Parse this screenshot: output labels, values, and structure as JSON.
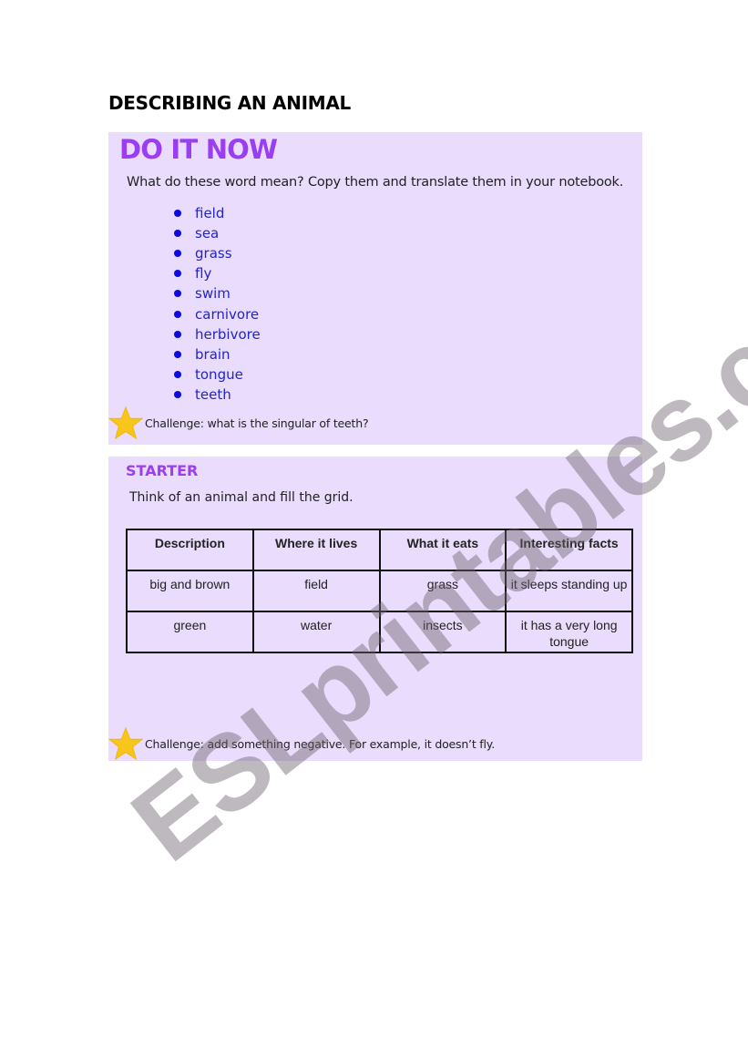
{
  "document": {
    "title": "DESCRIBING AN ANIMAL"
  },
  "do_it_now": {
    "heading": "DO IT NOW",
    "instruction": "What do these word mean? Copy them and translate them in your notebook.",
    "words": [
      "field",
      "sea",
      "grass",
      "fly",
      "swim",
      "carnivore",
      "herbivore",
      "brain",
      "tongue",
      "teeth"
    ],
    "challenge_icon": "star-icon",
    "challenge": "Challenge: what is the singular of teeth?"
  },
  "starter": {
    "heading": "STARTER",
    "instruction": "Think of an animal and fill the grid.",
    "table": {
      "headers": [
        "Description",
        "Where it lives",
        "What it eats",
        "Interesting facts"
      ],
      "rows": [
        [
          "big and brown",
          "field",
          "grass",
          "it sleeps standing up"
        ],
        [
          "green",
          "water",
          "insects",
          "it has a very long tongue"
        ]
      ]
    },
    "challenge_icon": "star-icon",
    "challenge": "Challenge: add something negative. For example, it doesn’t fly."
  },
  "watermark": {
    "text": "ESLprintables.com"
  },
  "colors": {
    "panel_bg": "#e9dcfd",
    "heading_purple": "#9b3df0",
    "word_blue": "#2323c8",
    "star_yellow": "#f7c51c"
  }
}
